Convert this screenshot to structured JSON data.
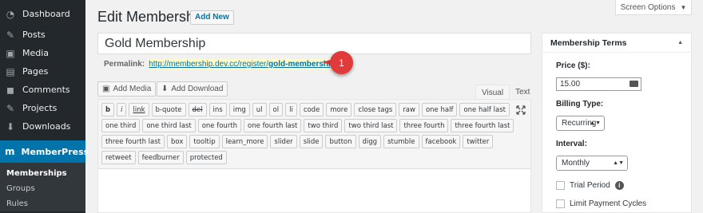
{
  "sidebar": {
    "items": [
      {
        "label": "Dashboard",
        "icon": "dashboard-icon"
      },
      {
        "label": "Posts",
        "icon": "pin-icon"
      },
      {
        "label": "Media",
        "icon": "media-icon"
      },
      {
        "label": "Pages",
        "icon": "page-icon"
      },
      {
        "label": "Comments",
        "icon": "comment-icon"
      },
      {
        "label": "Projects",
        "icon": "pin-icon"
      },
      {
        "label": "Downloads",
        "icon": "download-icon"
      },
      {
        "label": "MemberPress",
        "icon": "memberpress-icon"
      }
    ],
    "submenu": [
      {
        "label": "Memberships"
      },
      {
        "label": "Groups"
      },
      {
        "label": "Rules"
      }
    ]
  },
  "header": {
    "title": "Edit Membership",
    "add_new": "Add New",
    "screen_options": "Screen Options"
  },
  "post_title": "Gold Membership",
  "permalink": {
    "label": "Permalink:",
    "url_prefix": "http://membership.dev.cc/register/",
    "slug": "gold-membership",
    "suffix": "/",
    "callout_number": "1"
  },
  "media_buttons": {
    "add_media": "Add Media",
    "add_download": "Add Download"
  },
  "editor_tabs": {
    "visual": "Visual",
    "text": "Text"
  },
  "quicktags": {
    "row1": [
      "b",
      "i",
      "link",
      "b-quote",
      "del",
      "ins",
      "img",
      "ul",
      "ol",
      "li",
      "code",
      "more",
      "close tags",
      "raw",
      "one half",
      "one half last"
    ],
    "row2": [
      "one third",
      "one third last",
      "one fourth",
      "one fourth last",
      "two third",
      "two third last",
      "three fourth",
      "three fourth last"
    ],
    "row3": [
      "three fourth last",
      "box",
      "tooltip",
      "learn_more",
      "slider",
      "slide",
      "button",
      "digg",
      "stumble",
      "facebook",
      "twitter"
    ],
    "row4": [
      "retweet",
      "feedburner",
      "protected"
    ]
  },
  "terms": {
    "title": "Membership Terms",
    "price_label": "Price ($):",
    "price_value": "15.00",
    "billing_label": "Billing Type:",
    "billing_value": "Recurring",
    "interval_label": "Interval:",
    "interval_value": "Monthly",
    "trial_label": "Trial Period",
    "limit_label": "Limit Payment Cycles"
  },
  "colors": {
    "sidebar_bg": "#23282d",
    "active": "#0073aa",
    "callout": "#e03a3a",
    "link": "#0073aa"
  }
}
